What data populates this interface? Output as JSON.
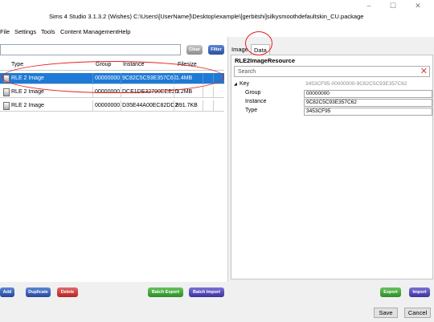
{
  "window": {
    "title": "Sims 4 Studio 3.1.3.2 (Wishes)  C:\\Users\\[UserName]\\Desktop\\example\\[gerbitshi]silkysmoothdefaultskin_CU.package",
    "minimize_glyph": "–",
    "maximize_glyph": "☐",
    "close_glyph": "✕"
  },
  "menu": [
    "File",
    "Settings",
    "Tools",
    "Content Management",
    "Help"
  ],
  "toolbar": {
    "clear_label": "Clear",
    "filter_label": "Filter",
    "search_value": ""
  },
  "grid": {
    "columns": [
      "Type",
      "Group",
      "Instance",
      "Filesize"
    ],
    "rows": [
      {
        "type": "RLE 2 Image",
        "group": "00000000",
        "instance": "9C82C5C93E357C62",
        "filesize": "1.4MB",
        "selected": true
      },
      {
        "type": "RLE 2 Image",
        "group": "00000000",
        "instance": "DCE1DE32790EEE2D",
        "filesize": "1.2MB",
        "selected": false
      },
      {
        "type": "RLE 2 Image",
        "group": "00000000",
        "instance": "D35E44A00EC82DD2",
        "filesize": "891.7KB",
        "selected": false
      }
    ]
  },
  "tabs": [
    "Image",
    "Data"
  ],
  "active_tab": "Data",
  "properties": {
    "title": "RLE2ImageResource",
    "search_placeholder": "Search",
    "clear_glyph": "✕",
    "key_toggle": "◢",
    "key_label": "Key",
    "key_summary": "3453CF95-00000000-9C82C5C93E357C62",
    "fields": [
      {
        "name": "Group",
        "value": "00000000"
      },
      {
        "name": "Instance",
        "value": "9C82C5C93E357C62"
      },
      {
        "name": "Type",
        "value": "3453CF95"
      }
    ]
  },
  "actions": {
    "add": "Add",
    "duplicate": "Duplicate",
    "delete": "Delete",
    "batch_export": "Batch Export",
    "batch_import": "Batch Import",
    "export": "Export",
    "import": "Import"
  },
  "dialog": {
    "save": "Save",
    "cancel": "Cancel"
  },
  "colors": {
    "selection": "#1e7ad6",
    "annotation": "#e52020"
  }
}
